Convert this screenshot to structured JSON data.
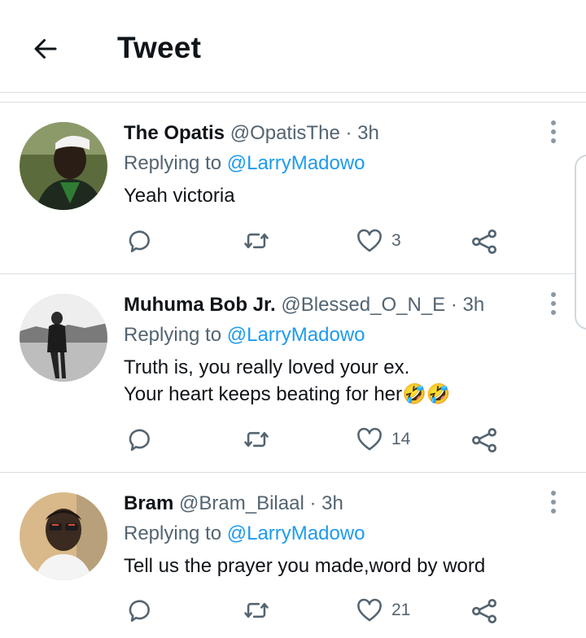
{
  "header": {
    "title": "Tweet"
  },
  "colors": {
    "accent": "#1d9bf0",
    "secondary_text": "#536471",
    "divider": "#d9dfe3"
  },
  "tweets": [
    {
      "name": "The Opatis",
      "handle": "@OpatisThe",
      "time": "· 3h",
      "replying_prefix": "Replying to",
      "replying_to": "@LarryMadowo",
      "text_lines": [
        "Yeah victoria"
      ],
      "likes": "3"
    },
    {
      "name": "Muhuma Bob Jr.",
      "handle": "@Blessed_O_N_E",
      "time": "· 3h",
      "replying_prefix": "Replying to",
      "replying_to": "@LarryMadowo",
      "text_lines": [
        "Truth is, you really loved your ex.",
        "Your heart keeps beating for her🤣🤣"
      ],
      "likes": "14"
    },
    {
      "name": "Bram",
      "handle": "@Bram_Bilaal",
      "time": "· 3h",
      "replying_prefix": "Replying to",
      "replying_to": "@LarryMadowo",
      "text_lines": [
        "Tell us the prayer you made,word by word"
      ],
      "likes": "21"
    }
  ],
  "icons": {
    "back": "arrow-left-icon",
    "reply": "reply-bubble-icon",
    "retweet": "retweet-icon",
    "like": "heart-icon",
    "share": "share-icon",
    "more": "more-vertical-icon"
  }
}
